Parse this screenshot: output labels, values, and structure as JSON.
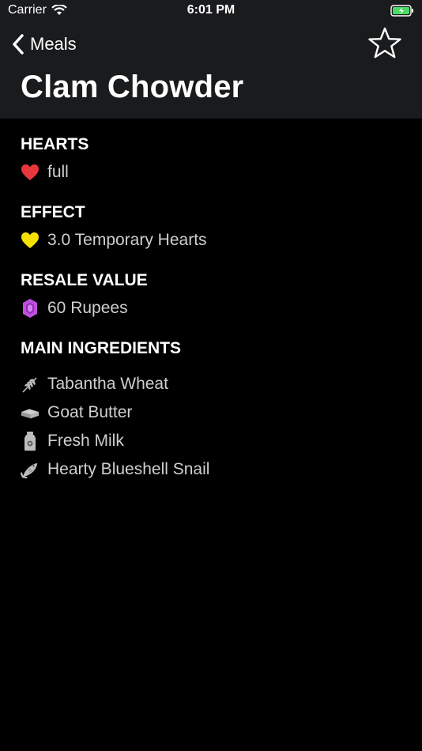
{
  "status": {
    "carrier": "Carrier",
    "time": "6:01 PM"
  },
  "nav": {
    "back_label": "Meals"
  },
  "page_title": "Clam Chowder",
  "sections": {
    "hearts": {
      "title": "HEARTS",
      "value": "full"
    },
    "effect": {
      "title": "EFFECT",
      "value": "3.0 Temporary Hearts"
    },
    "resale": {
      "title": "RESALE VALUE",
      "value": "60 Rupees"
    },
    "ingredients": {
      "title": "MAIN INGREDIENTS",
      "items": [
        {
          "label": "Tabantha Wheat",
          "icon": "wheat-icon"
        },
        {
          "label": "Goat Butter",
          "icon": "butter-icon"
        },
        {
          "label": "Fresh Milk",
          "icon": "milk-icon"
        },
        {
          "label": "Hearty Blueshell Snail",
          "icon": "fish-icon"
        }
      ]
    }
  },
  "colors": {
    "header_bg": "#1a1b1d",
    "heart_red": "#e8363f",
    "heart_yellow": "#f5e000",
    "rupee_purple": "#c04fe0"
  }
}
